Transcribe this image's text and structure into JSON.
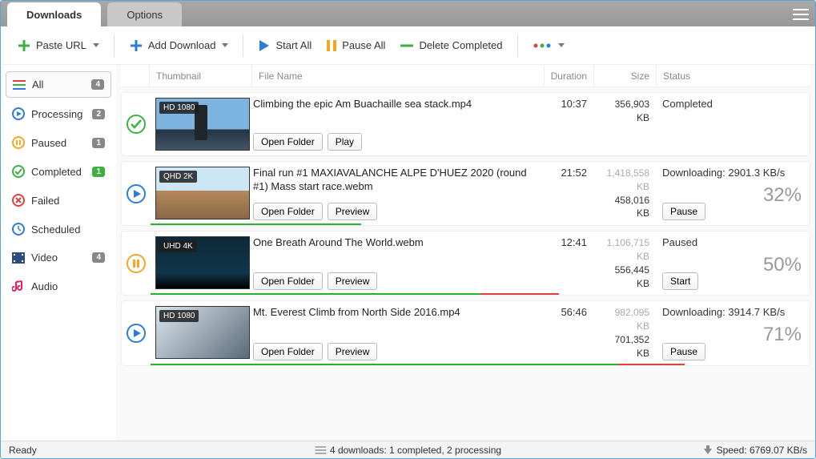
{
  "tabs": {
    "downloads": "Downloads",
    "options": "Options"
  },
  "toolbar": {
    "paste_url": "Paste URL",
    "add_download": "Add Download",
    "start_all": "Start All",
    "pause_all": "Pause All",
    "delete_completed": "Delete Completed"
  },
  "sidebar": [
    {
      "icon": "list",
      "label": "All",
      "badge": "4",
      "badge_color": "gray",
      "active": true
    },
    {
      "icon": "processing",
      "label": "Processing",
      "badge": "2",
      "badge_color": "gray"
    },
    {
      "icon": "paused",
      "label": "Paused",
      "badge": "1",
      "badge_color": "gray"
    },
    {
      "icon": "completed",
      "label": "Completed",
      "badge": "1",
      "badge_color": "green"
    },
    {
      "icon": "failed",
      "label": "Failed"
    },
    {
      "icon": "scheduled",
      "label": "Scheduled"
    },
    {
      "icon": "video",
      "label": "Video",
      "badge": "4",
      "badge_color": "gray"
    },
    {
      "icon": "audio",
      "label": "Audio"
    }
  ],
  "columns": {
    "thumbnail": "Thumbnail",
    "filename": "File Name",
    "duration": "Duration",
    "size": "Size",
    "status": "Status"
  },
  "rows": [
    {
      "state": "completed",
      "quality": "HD 1080",
      "thumb_class": "thumb1",
      "filename": "Climbing the epic Am Buachaille sea stack.mp4",
      "duration": "10:37",
      "size_total": "356,903 KB",
      "status_text": "Completed",
      "buttons": [
        "Open Folder",
        "Play"
      ]
    },
    {
      "state": "downloading",
      "quality": "QHD 2K",
      "thumb_class": "thumb2",
      "filename": "Final run #1 MAXIAVALANCHE ALPE D'HUEZ 2020 (round #1) Mass start race.webm",
      "duration": "21:52",
      "size_total": "1,418,558 KB",
      "size_done": "458,016 KB",
      "status_text": "Downloading: 2901.3 KB/s",
      "percent": "32%",
      "buttons": [
        "Open Folder",
        "Preview"
      ],
      "action": "Pause",
      "progress_green": 32,
      "progress_red": 0
    },
    {
      "state": "paused",
      "quality": "UHD 4K",
      "thumb_class": "thumb3",
      "filename": "One Breath Around The World.webm",
      "duration": "12:41",
      "size_total": "1,106,715 KB",
      "size_done": "556,445 KB",
      "status_text": "Paused",
      "percent": "50%",
      "buttons": [
        "Open Folder",
        "Preview"
      ],
      "action": "Start",
      "progress_green": 50,
      "progress_red": 12
    },
    {
      "state": "downloading",
      "quality": "HD 1080",
      "thumb_class": "thumb4",
      "filename": "Mt. Everest Climb from North Side 2016.mp4",
      "duration": "56:46",
      "size_total": "982,095 KB",
      "size_done": "701,352 KB",
      "status_text": "Downloading: 3914.7 KB/s",
      "percent": "71%",
      "buttons": [
        "Open Folder",
        "Preview"
      ],
      "action": "Pause",
      "progress_green": 71,
      "progress_red": 10
    }
  ],
  "statusbar": {
    "left": "Ready",
    "mid": "4 downloads: 1 completed, 2 processing",
    "right": "Speed: 6769.07 KB/s"
  }
}
